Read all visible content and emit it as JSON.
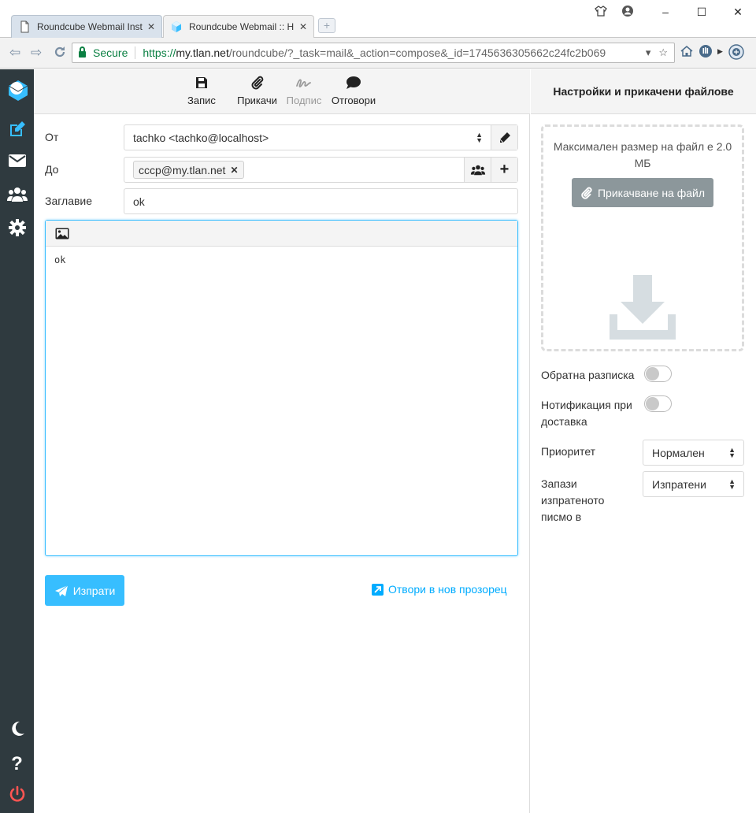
{
  "browser": {
    "tabs": [
      {
        "title": "Roundcube Webmail Inst",
        "active": false
      },
      {
        "title": "Roundcube Webmail :: H",
        "active": true
      }
    ],
    "address": {
      "secure_label": "Secure",
      "url_scheme": "https://",
      "url_host": "my.tlan.net",
      "url_path": "/roundcube/?_task=mail&_action=compose&_id=1745636305662c24fc2b069"
    }
  },
  "toolbar": {
    "save": "Запис",
    "attach": "Прикачи",
    "signature": "Подпис",
    "responses": "Отговори"
  },
  "compose": {
    "from_label": "От",
    "from_value": "tachko <tachko@localhost>",
    "to_label": "До",
    "to_recipient": "cccp@my.tlan.net",
    "subject_label": "Заглавие",
    "subject_value": "ok",
    "body": "ok",
    "send_label": "Изпрати",
    "new_window_label": "Отвори в нов прозорец"
  },
  "options": {
    "header": "Настройки и прикачени файлове",
    "max_size_text": "Максимален размер на файл е 2.0 МБ",
    "attach_button": "Прикачване на файл",
    "return_receipt_label": "Обратна разписка",
    "return_receipt_on": false,
    "dsn_label": "Нотификация при доставка",
    "dsn_on": false,
    "priority_label": "Приоритет",
    "priority_value": "Нормален",
    "save_sent_label": "Запази изпратеното писмо в",
    "save_sent_value": "Изпратени"
  },
  "colors": {
    "primary": "#37beff",
    "sidebar": "#2f3a3f",
    "logout": "#ff5552",
    "compose_active": "#37beff"
  }
}
